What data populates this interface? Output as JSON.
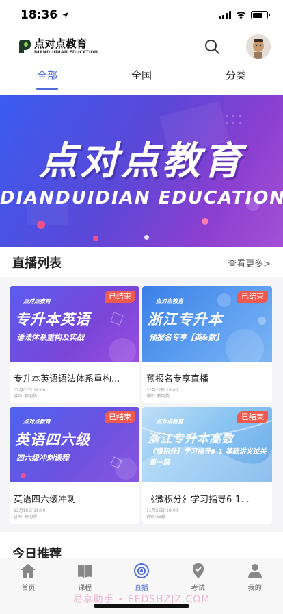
{
  "status": {
    "time": "18:36"
  },
  "header": {
    "logo_cn": "点对点教育",
    "logo_en": "DIANDUIDIAN EDUCATION"
  },
  "tabs": [
    {
      "label": "全部",
      "active": true
    },
    {
      "label": "全国",
      "active": false
    },
    {
      "label": "分类",
      "active": false
    }
  ],
  "banner": {
    "title": "点对点教育",
    "subtitle": "DIANDUIDIAN EDUCATION"
  },
  "live": {
    "section_title": "直播列表",
    "more": "查看更多>",
    "cards": [
      {
        "brand": "点对点教育",
        "thumb_line1": "专升本英语",
        "thumb_line2": "语法体系重构及实战",
        "badge": "已结束",
        "title": "专升本英语语法体系重构...",
        "date": "01月02日 18:00",
        "teacher": "讲师: 韩明扬"
      },
      {
        "brand": "点对点教育",
        "thumb_line1": "浙江专升本",
        "thumb_line2": "预报名专享【英&数】",
        "badge": "已结束",
        "title": "预报名专享直播",
        "date": "12月22日 18:00",
        "teacher": "讲师: 韩明扬"
      },
      {
        "brand": "点对点教育",
        "thumb_line1": "英语四六级",
        "thumb_line2": "四六级冲刺课程",
        "badge": "已结束",
        "title": "英语四六级冲刺",
        "date": "12月18日 18:00",
        "teacher": "讲师: 韩明扬"
      },
      {
        "brand": "点对点教育",
        "thumb_line1": "浙江专升本高数",
        "thumb_line2": "《微积分》学习指导6-1 基础讲义过关第一篇",
        "badge": "已结束",
        "title": "《微积分》学习指导6-1...",
        "date": "11月25日 19:00",
        "teacher": "讲师: 田毅"
      }
    ]
  },
  "today": {
    "title": "今日推荐"
  },
  "nav": [
    {
      "label": "首页",
      "icon": "home-icon",
      "active": false
    },
    {
      "label": "课程",
      "icon": "book-icon",
      "active": false
    },
    {
      "label": "直播",
      "icon": "live-icon",
      "active": true
    },
    {
      "label": "考试",
      "icon": "exam-icon",
      "active": false
    },
    {
      "label": "我的",
      "icon": "user-icon",
      "active": false
    }
  ],
  "watermark": "易享助手 • EEDSHZJZ.COM",
  "colors": {
    "accent": "#4f6bd8",
    "badge": "#ef5a4e"
  }
}
